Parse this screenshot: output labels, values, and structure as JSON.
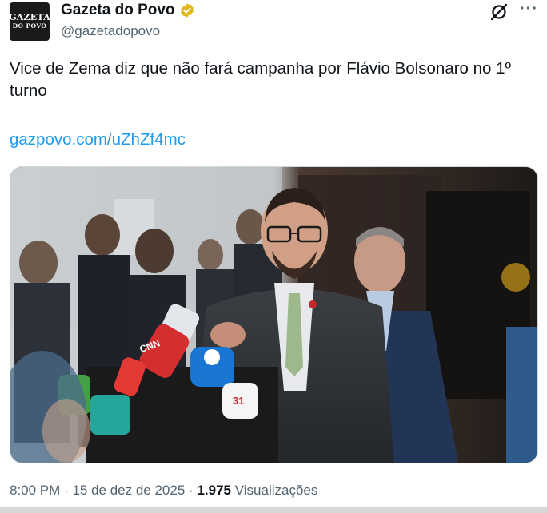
{
  "account": {
    "display_name": "Gazeta do Povo",
    "handle": "@gazetadopovo",
    "avatar_text_top": "GAZETA",
    "avatar_text_bottom": "DO POVO",
    "verified_color": "#e2b719"
  },
  "header_actions": {
    "grok_icon": "grok-icon",
    "more_label": "···"
  },
  "tweet": {
    "text": "Vice de Zema diz que não fará campanha por Flávio Bolsonaro no 1º turno",
    "link": "gazpovo.com/uZhZf4mc",
    "link_color": "#1d9bf0"
  },
  "media": {
    "alt": "",
    "microphone_labels": [
      "CNN",
      "31"
    ]
  },
  "meta": {
    "time": "8:00 PM",
    "separator": "·",
    "date": "15 de dez de 2025",
    "views_count": "1.975",
    "views_label": "Visualizações"
  }
}
